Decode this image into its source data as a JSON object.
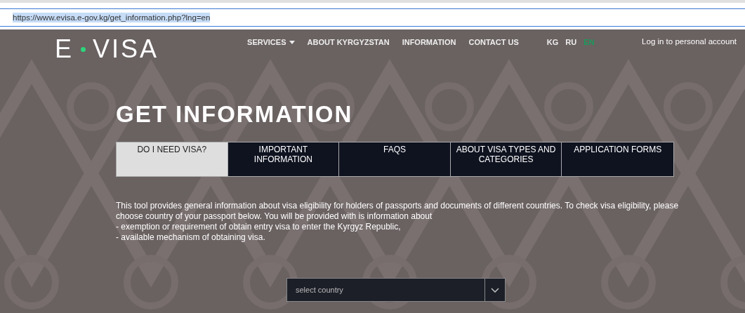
{
  "browser": {
    "address": "https://www.evisa.e-gov.kg/get_information.php?lng=en"
  },
  "logo": {
    "left": "E",
    "right": "VISA"
  },
  "nav": [
    {
      "label": "SERVICES",
      "dropdown": true
    },
    {
      "label": "ABOUT KYRGYZSTAN",
      "dropdown": false
    },
    {
      "label": "INFORMATION",
      "dropdown": false
    },
    {
      "label": "CONTACT US",
      "dropdown": false
    }
  ],
  "languages": [
    {
      "label": "KG",
      "selected": false
    },
    {
      "label": "RU",
      "selected": false
    },
    {
      "label": "EN",
      "selected": true
    }
  ],
  "login": "Log in to personal account",
  "title": "GET INFORMATION",
  "tabs": [
    {
      "label": "DO I NEED VISA?",
      "selected": true
    },
    {
      "label": "IMPORTANT INFORMATION",
      "selected": false
    },
    {
      "label": "FAQS",
      "selected": false
    },
    {
      "label": "ABOUT VISA TYPES AND CATEGORIES",
      "selected": false
    },
    {
      "label": "APPLICATION FORMS",
      "selected": false
    }
  ],
  "intro": [
    "This tool provides general information about visa eligibility for holders of passports and documents of different countries. To check visa eligibility, please choose country of your passport below. You will be provided with is information about",
    "- exemption or requirement of obtain entry visa to enter the Kyrgyz Republic,",
    "- available mechanism of obtaining visa."
  ],
  "country_select": {
    "placeholder": "select country"
  }
}
